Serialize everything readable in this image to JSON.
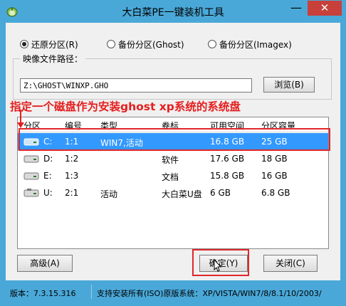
{
  "window": {
    "title": "大白菜PE一键装机工具",
    "minimize": "—",
    "close": "✕"
  },
  "mode": {
    "options": [
      {
        "label": "还原分区(R)",
        "selected": true
      },
      {
        "label": "备份分区(Ghost)",
        "selected": false
      },
      {
        "label": "备份分区(Imagex)",
        "selected": false
      }
    ]
  },
  "image": {
    "label": "映像文件路径：",
    "value": "Z:\\GHOST\\WINXP.GHO",
    "browse_label": "浏览(B)"
  },
  "annotation": "指定一个磁盘作为安装ghost xp系统的系统盘",
  "table": {
    "headers": [
      "分区",
      "编号",
      "类型",
      "卷标",
      "可用空间",
      "分区容量"
    ],
    "rows": [
      [
        "C:",
        "1:1",
        "WIN7,活动",
        "",
        "16.8 GB",
        "25 GB"
      ],
      [
        "D:",
        "1:2",
        "",
        "软件",
        "17.6 GB",
        "18 GB"
      ],
      [
        "E:",
        "1:3",
        "",
        "文档",
        "15.8 GB",
        "16 GB"
      ],
      [
        "U:",
        "2:1",
        "活动",
        "大白菜U盘",
        "6 GB",
        "6.8 GB"
      ]
    ]
  },
  "buttons": {
    "advanced": "高级(A)",
    "ok": "确定(Y)",
    "close": "关闭(C)"
  },
  "status": {
    "version": "版本：7.3.15.316",
    "support": "支持安装所有(ISO)原版系统：XP/VISTA/WIN7/8/8.1/10/2003/"
  },
  "colors": {
    "frame": "#4aa8d8",
    "selection": "#3399ff",
    "highlight": "#e0272a"
  }
}
